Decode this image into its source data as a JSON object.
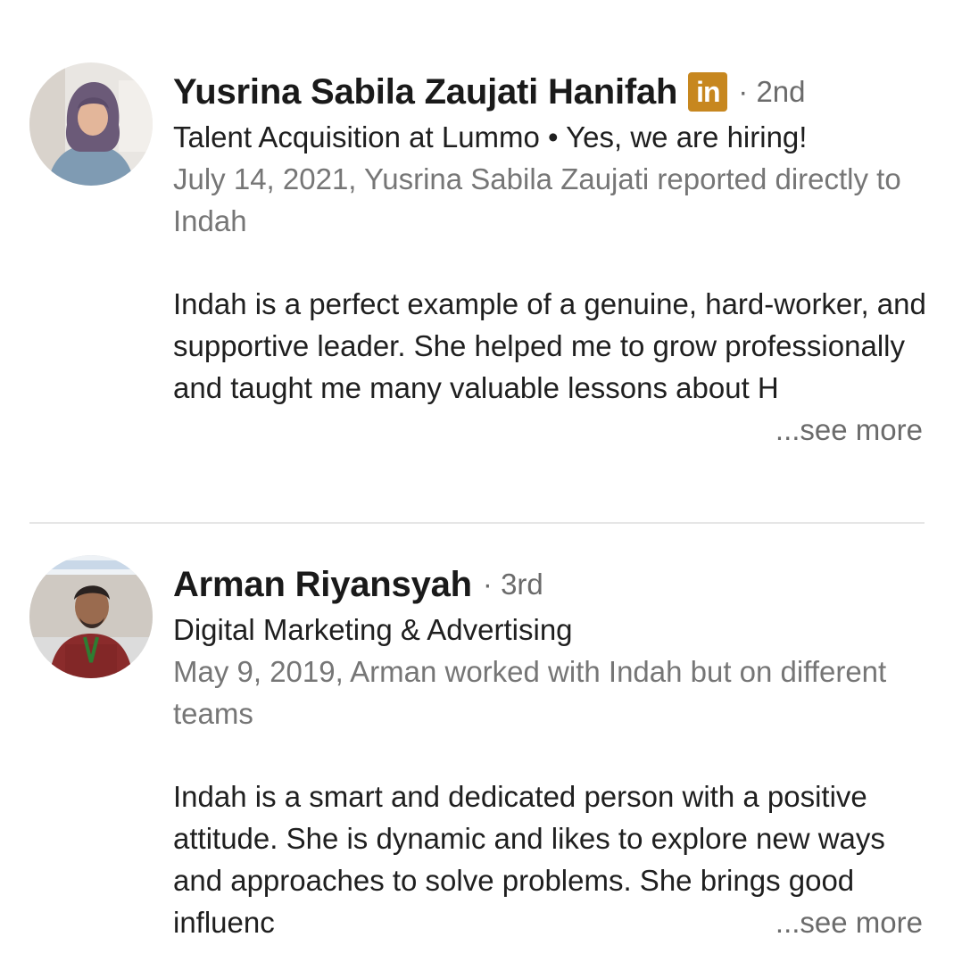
{
  "recommendations": [
    {
      "name": "Yusrina Sabila Zaujati Hanifah",
      "badge": "in",
      "degree": "· 2nd",
      "headline": "Talent Acquisition at Lummo • Yes, we are hiring!",
      "relation": "July 14, 2021, Yusrina Sabila Zaujati reported directly to Indah",
      "text": "Indah is a perfect example of a genuine, hard-worker, and supportive leader. She helped me to grow professionally and taught me many valuable lessons about H",
      "see_more": "...see more"
    },
    {
      "name": "Arman Riyansyah",
      "degree": "· 3rd",
      "headline": "Digital Marketing & Advertising",
      "relation": "May 9, 2019, Arman worked with Indah but on different teams",
      "text": "Indah is a smart and dedicated person with a positive attitude. She is dynamic and likes to explore new ways and approaches to solve problems. She brings good influenc",
      "see_more": "...see more"
    }
  ],
  "colors": {
    "linkedin_badge": "#c7871f",
    "secondary_text": "#767676",
    "divider": "#e6e6e6"
  }
}
